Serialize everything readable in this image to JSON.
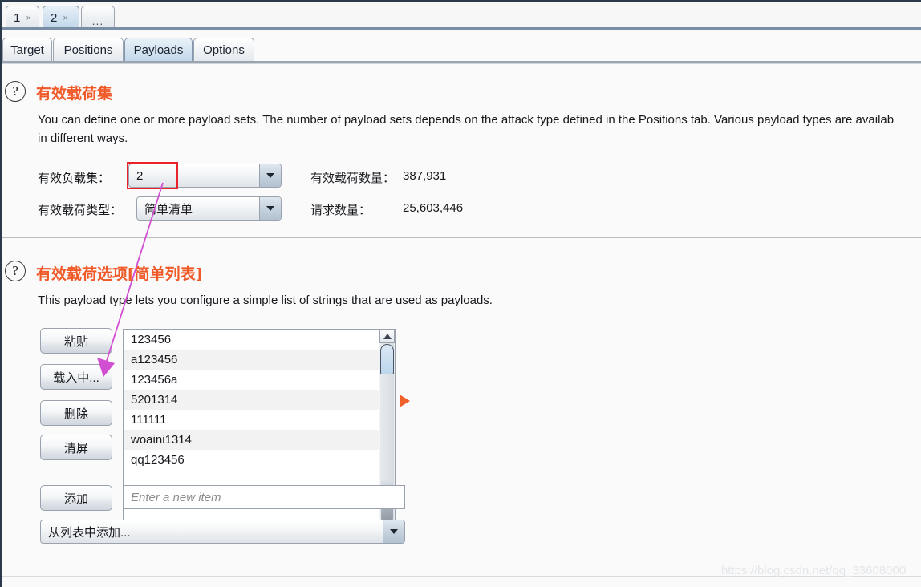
{
  "window": {
    "attack_tabs": [
      {
        "label": "1",
        "close": "×",
        "selected": false
      },
      {
        "label": "2",
        "close": "×",
        "selected": true
      }
    ],
    "overflow_tab": "...",
    "main_tabs": [
      {
        "label": "Target",
        "selected": false
      },
      {
        "label": "Positions",
        "selected": false
      },
      {
        "label": "Payloads",
        "selected": true
      },
      {
        "label": "Options",
        "selected": false
      }
    ]
  },
  "payload_sets": {
    "help_icon": "?",
    "title": "有效载荷集",
    "description_line1": "You can define one or more payload sets. The number of payload sets depends on the attack type defined in the Positions tab. Various payload types are availab",
    "description_line2": "in different ways.",
    "set_label": "有效负载集：",
    "set_value": "2",
    "type_label": "有效载荷类型：",
    "type_value": "简单清单",
    "count_label": "有效载荷数量：",
    "count_value": "387,931",
    "requests_label": "请求数量：",
    "requests_value": "25,603,446",
    "dropdown_arrow": "▼",
    "highlight_color": "#e8232a",
    "title_color": "#f05a28"
  },
  "payload_options": {
    "help_icon": "?",
    "title": "有效载荷选项[简单列表]",
    "description": "This payload type lets you configure a simple list of strings that are used as payloads.",
    "buttons": [
      {
        "label": "粘贴"
      },
      {
        "label": "载入中..."
      },
      {
        "label": "删除"
      },
      {
        "label": "清屏"
      }
    ],
    "add_button": "添加",
    "new_item_placeholder": "Enter a new item",
    "add_from_list_label": "从列表中添加...",
    "add_from_list_arrow": "▼",
    "payload_items": [
      "123456",
      "a123456",
      "123456a",
      "5201314",
      "111111",
      "woaini1314",
      "qq123456"
    ],
    "scroll_up_icon": "▲",
    "scroll_down_icon": "▼"
  },
  "annotations": {
    "arrow_color": "#d14fd1",
    "marker_color": "#f0602a"
  },
  "watermark": "https://blog.csdn.net/qq_33608000"
}
